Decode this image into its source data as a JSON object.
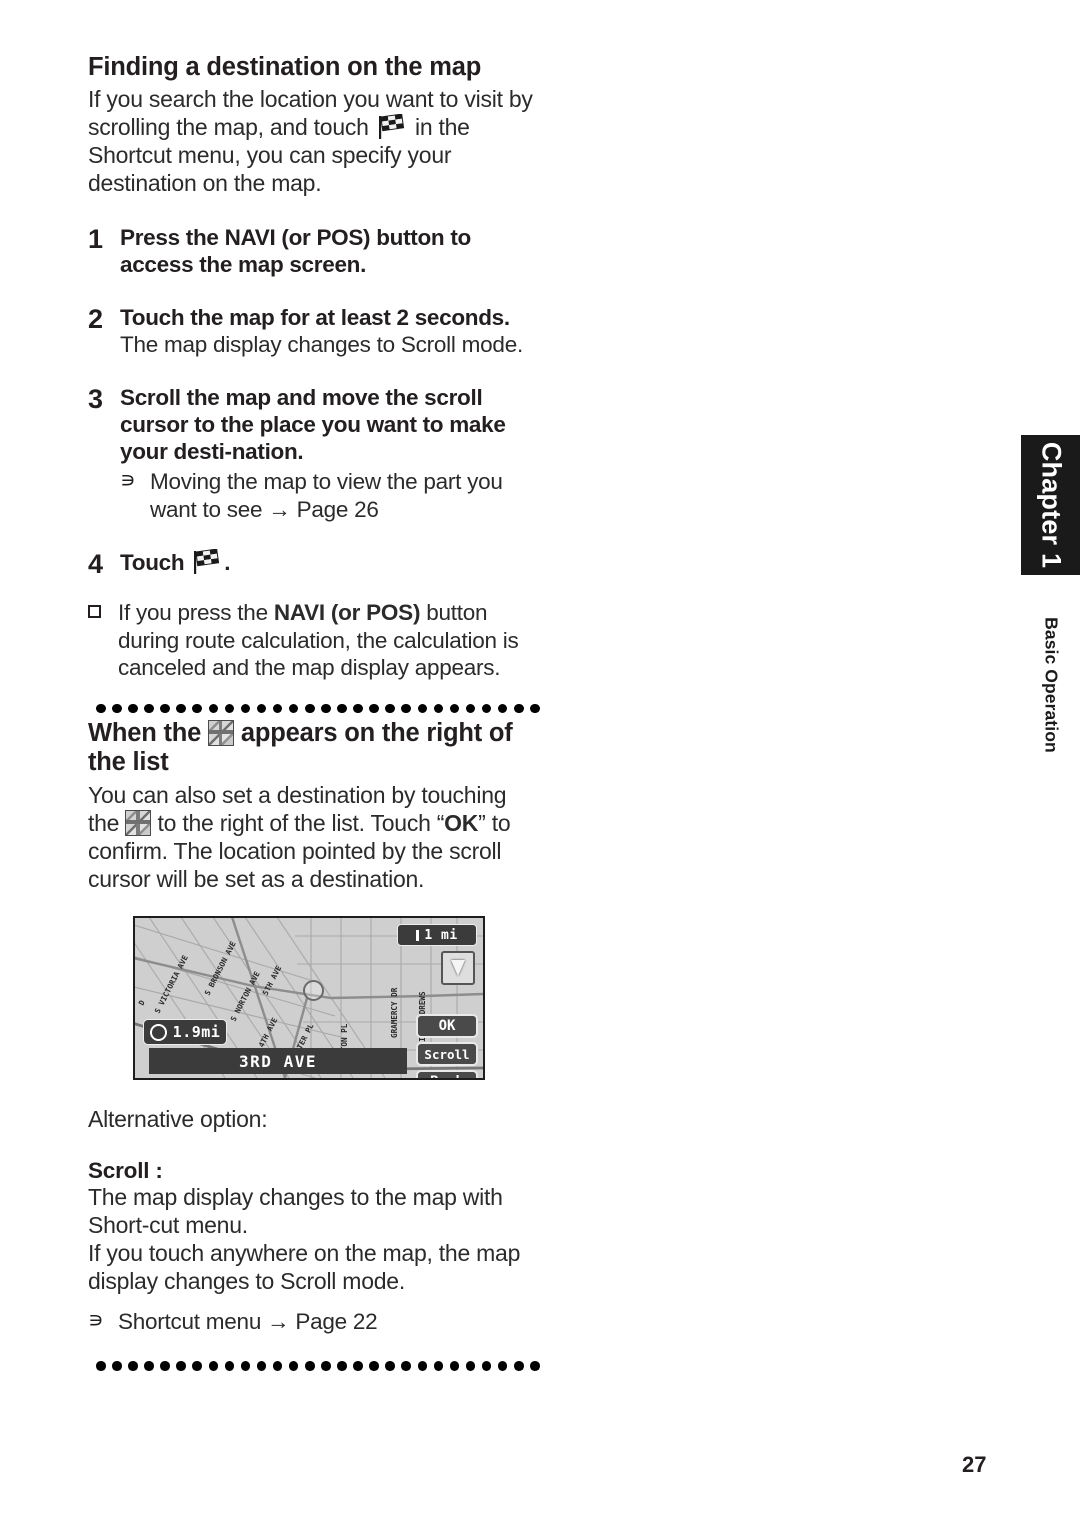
{
  "page": {
    "number": "27",
    "chapter_tab": "Chapter 1",
    "chapter_subtitle": "Basic Operation"
  },
  "section1": {
    "title": "Finding a destination on the map",
    "intro_part1": "If you search the location you want to visit by scrolling the map, and touch ",
    "intro_icon": "checkered-flag-icon",
    "intro_part2": " in the Shortcut menu, you can specify your destination on the map."
  },
  "steps": [
    {
      "number": "1",
      "heading_pre": "Press the ",
      "heading_bold": "NAVI (or POS)",
      "heading_post": " button to access the map screen.",
      "sub": ""
    },
    {
      "number": "2",
      "heading_pre": "Touch the map for at least 2 seconds.",
      "heading_bold": "",
      "heading_post": "",
      "sub": "The map display changes to Scroll mode."
    },
    {
      "number": "3",
      "heading_pre": "Scroll the map and move the scroll cursor to the place you want to make your desti-nation.",
      "heading_bold": "",
      "heading_post": "",
      "sub": ""
    },
    {
      "number": "4",
      "heading_pre": "Touch ",
      "heading_bold": "",
      "heading_post": ".",
      "sub": ""
    }
  ],
  "step3_note": {
    "marker": "loop-arrow-icon",
    "text": "Moving the map to view the part you want to see ",
    "arrow": "→",
    "page_ref": "Page 26"
  },
  "step4_note": {
    "marker": "hollow-square-bullet",
    "text_pre": "If you press the ",
    "text_bold": "NAVI (or POS)",
    "text_post": " button during route calculation, the calculation is canceled and the map display appears."
  },
  "separator": {
    "dot_count": 28
  },
  "section2": {
    "title_pre": "When the ",
    "title_icon": "map-tile-icon",
    "title_post": " appears on the right of the list",
    "body_pre": "You can also set a destination by touching the ",
    "body_icon": "map-tile-icon",
    "body_mid": " to the right of the list. Touch “",
    "body_bold": "OK",
    "body_post": "” to confirm. The location pointed by the scroll cursor will be set as a destination."
  },
  "map_screenshot": {
    "scale_label": "1 mi",
    "scale_icon": "scale-bar-icon",
    "compass_icon": "compass-arrow-icon",
    "distance_label": "1.9mi",
    "distance_icon": "clock-icon",
    "street_bar_label": "3RD AVE",
    "cursor_icon": "scroll-cursor-icon",
    "buttons": [
      {
        "label": "OK",
        "name": "ok-button"
      },
      {
        "label": "Scroll",
        "name": "scroll-button"
      },
      {
        "label": "Back",
        "name": "back-button"
      }
    ],
    "street_labels": [
      "S VICTORIA AVE",
      "S BRONSON AVE",
      "S NORTON AVE",
      "5TH AVE",
      "4TH AVE",
      "CHESTER PL",
      "S WILTON PL",
      "GRAMERCY DR",
      "S SAINT ANDREWS",
      "3RD AVE"
    ]
  },
  "alt": {
    "label": "Alternative option:",
    "option_title": "Scroll :",
    "option_body_1": "The map display changes to the map with Short-cut menu.",
    "option_body_2": "If you touch anywhere on the map, the map display changes to Scroll mode.",
    "note_marker": "loop-arrow-icon",
    "note_text": "Shortcut menu ",
    "note_arrow": "→",
    "note_page_ref": "Page 22"
  }
}
